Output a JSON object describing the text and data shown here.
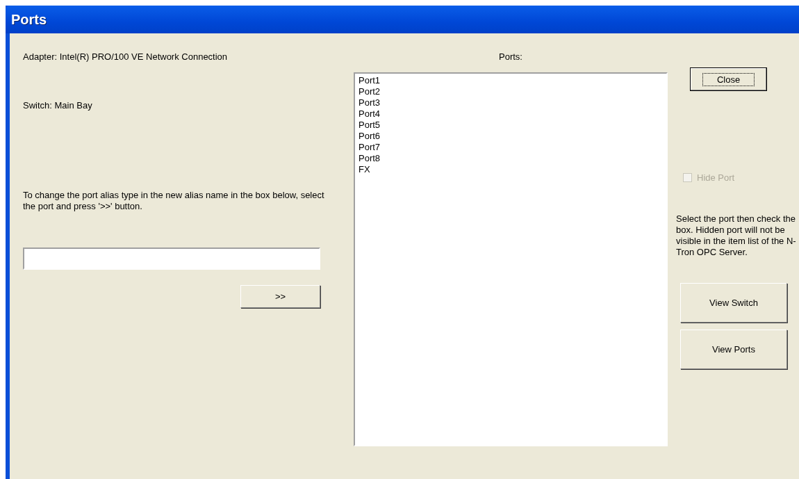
{
  "window": {
    "title": "Ports"
  },
  "adapter_label": "Adapter:  Intel(R) PRO/100 VE Network Connection",
  "switch_label": "Switch:  Main Bay",
  "alias_instructions": "To change the port alias type in the new alias name in the box below, select the port and press '>>' button.",
  "apply_alias_button": {
    "label": ">>"
  },
  "ports_label": "Ports:",
  "ports": [
    {
      "label": "Port1",
      "selected": false
    },
    {
      "label": "Port2",
      "selected": false
    },
    {
      "label": "Port3",
      "selected": false
    },
    {
      "label": "Port4",
      "selected": false
    },
    {
      "label": "Port5",
      "selected": false
    },
    {
      "label": "Port6",
      "selected": false
    },
    {
      "label": "Port7",
      "selected": false
    },
    {
      "label": "Port8",
      "selected": false
    },
    {
      "label": "FX",
      "selected": false
    }
  ],
  "close_button": {
    "label": "Close",
    "focused": true
  },
  "hide_port": {
    "label": "Hide Port",
    "checked": false,
    "disabled": true
  },
  "hide_help": "Select the port then check the box. Hidden port will not be visible in the item list of the N-Tron OPC Server.",
  "view_buttons": [
    {
      "label": "View Switch"
    },
    {
      "label": "View Ports"
    }
  ]
}
